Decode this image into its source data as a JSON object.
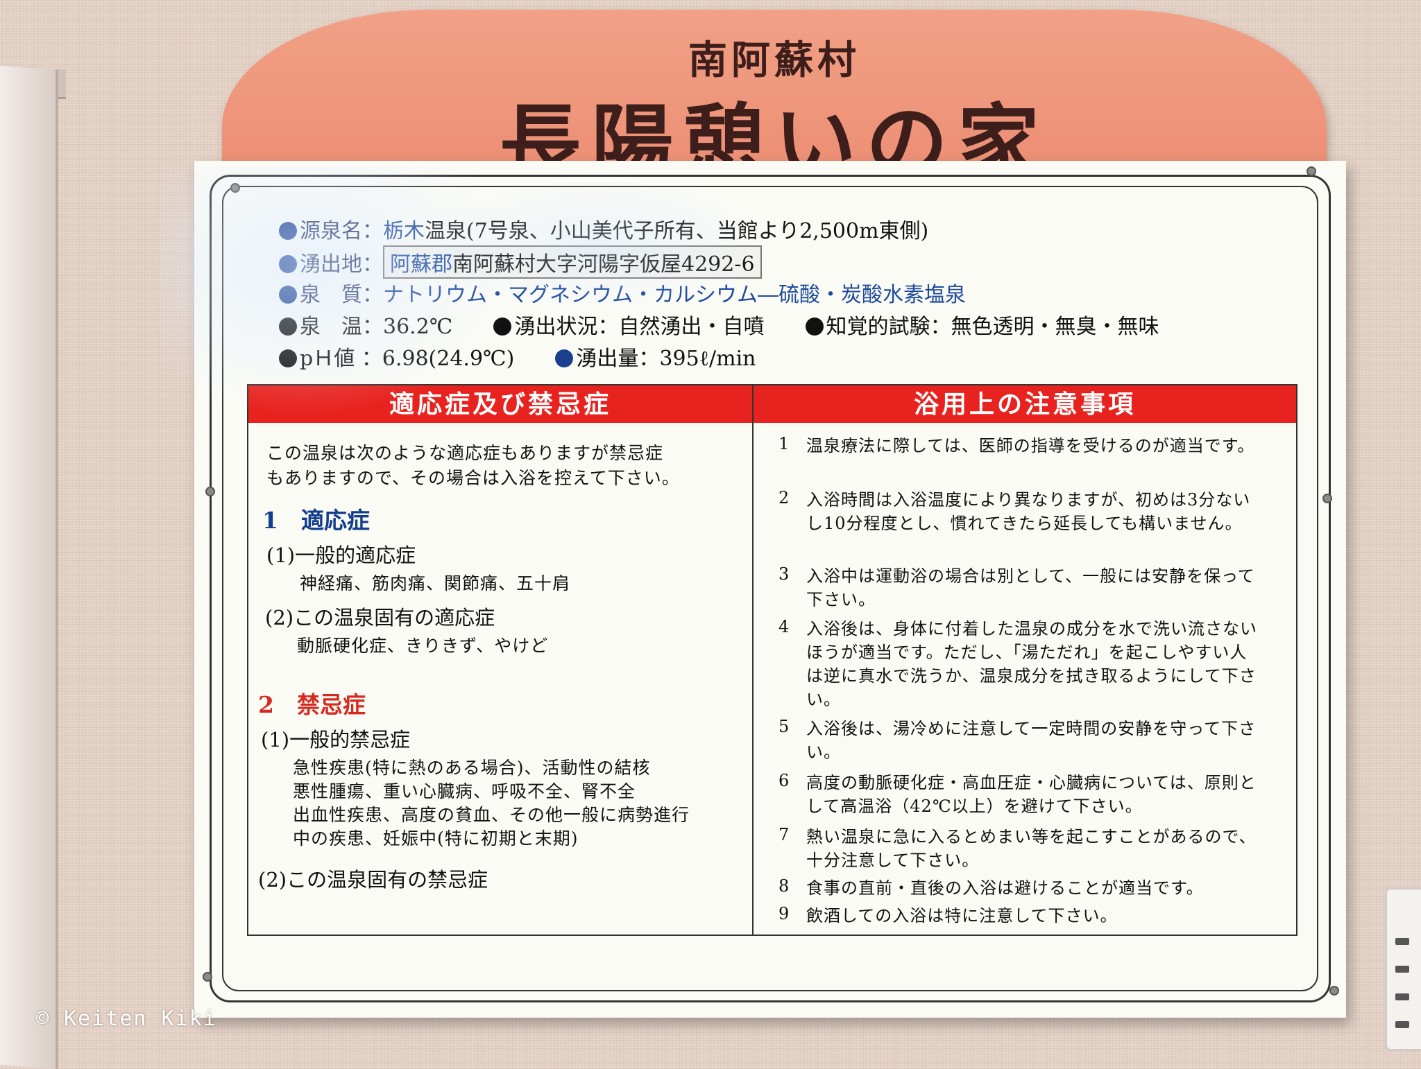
{
  "sign": {
    "subtitle": "南阿蘇村",
    "title": "長陽憩いの家"
  },
  "info": {
    "source": {
      "key": "源泉名：",
      "value_a": "栃木",
      "value_b": "温泉(7号泉、小山美代子所有、当館より2,500m東側)"
    },
    "location": {
      "key": "湧出地：",
      "value_a": "阿蘇郡",
      "value_b": "南阿蘇村大字河陽字仮屋4292-6"
    },
    "quality": {
      "key": "泉　質：",
      "value": "ナトリウム・マグネシウム・カルシウム―硫酸・炭酸水素塩泉"
    },
    "temp": {
      "key": "泉　温：",
      "value": "36.2℃"
    },
    "status": {
      "key": "湧出状況：",
      "value": "自然湧出・自噴"
    },
    "sensory": {
      "key": "知覚的試験：",
      "value": "無色透明・無臭・無味"
    },
    "ph": {
      "key": "pＨ値 ：",
      "value": "6.98(24.9℃)"
    },
    "flow": {
      "key": "湧出量：",
      "value": "395ℓ/min"
    }
  },
  "left_panel": {
    "heading": "適応症及び禁忌症",
    "intro_1": "この温泉は次のような適応症もありますが禁忌症",
    "intro_2": "もありますので、その場合は入浴を控えて下さい。",
    "indications": {
      "title": "1　適応症",
      "general_title": "(1)一般的適応症",
      "general_text": "神経痛、筋肉痛、関節痛、五十肩",
      "specific_title": "(2)この温泉固有の適応症",
      "specific_text": "動脈硬化症、きりきず、やけど"
    },
    "contraindications": {
      "title": "2　禁忌症",
      "general_title": "(1)一般的禁忌症",
      "general_lines": [
        "急性疾患(特に熱のある場合)、活動性の結核",
        "悪性腫瘍、重い心臓病、呼吸不全、腎不全",
        "出血性疾患、高度の貧血、その他一般に病勢進行",
        "中の疾患、妊娠中(特に初期と末期)"
      ],
      "specific_title": "(2)この温泉固有の禁忌症"
    }
  },
  "right_panel": {
    "heading": "浴用上の注意事項",
    "items": [
      {
        "num": "1",
        "text": "温泉療法に際しては、医師の指導を受けるのが適当です。"
      },
      {
        "num": "2",
        "text": "入浴時間は入浴温度により異なりますが、初めは3分ないし10分程度とし、慣れてきたら延長しても構いません。"
      },
      {
        "num": "3",
        "text": "入浴中は運動浴の場合は別として、一般には安静を保って下さい。"
      },
      {
        "num": "4",
        "text": "入浴後は、身体に付着した温泉の成分を水で洗い流さないほうが適当です。ただし、「湯ただれ」を起こしやすい人は逆に真水で洗うか、温泉成分を拭き取るようにして下さい。"
      },
      {
        "num": "5",
        "text": "入浴後は、湯冷めに注意して一定時間の安静を守って下さい。"
      },
      {
        "num": "6",
        "text": "高度の動脈硬化症・高血圧症・心臓病については、原則として高温浴（42℃以上）を避けて下さい。"
      },
      {
        "num": "7",
        "text": "熱い温泉に急に入るとめまい等を起こすことがあるので、十分注意して下さい。"
      },
      {
        "num": "8",
        "text": "食事の直前・直後の入浴は避けることが適当です。"
      },
      {
        "num": "9",
        "text": "飲酒しての入浴は特に注意して下さい。"
      }
    ]
  },
  "credit": "© Keiten Kiki"
}
